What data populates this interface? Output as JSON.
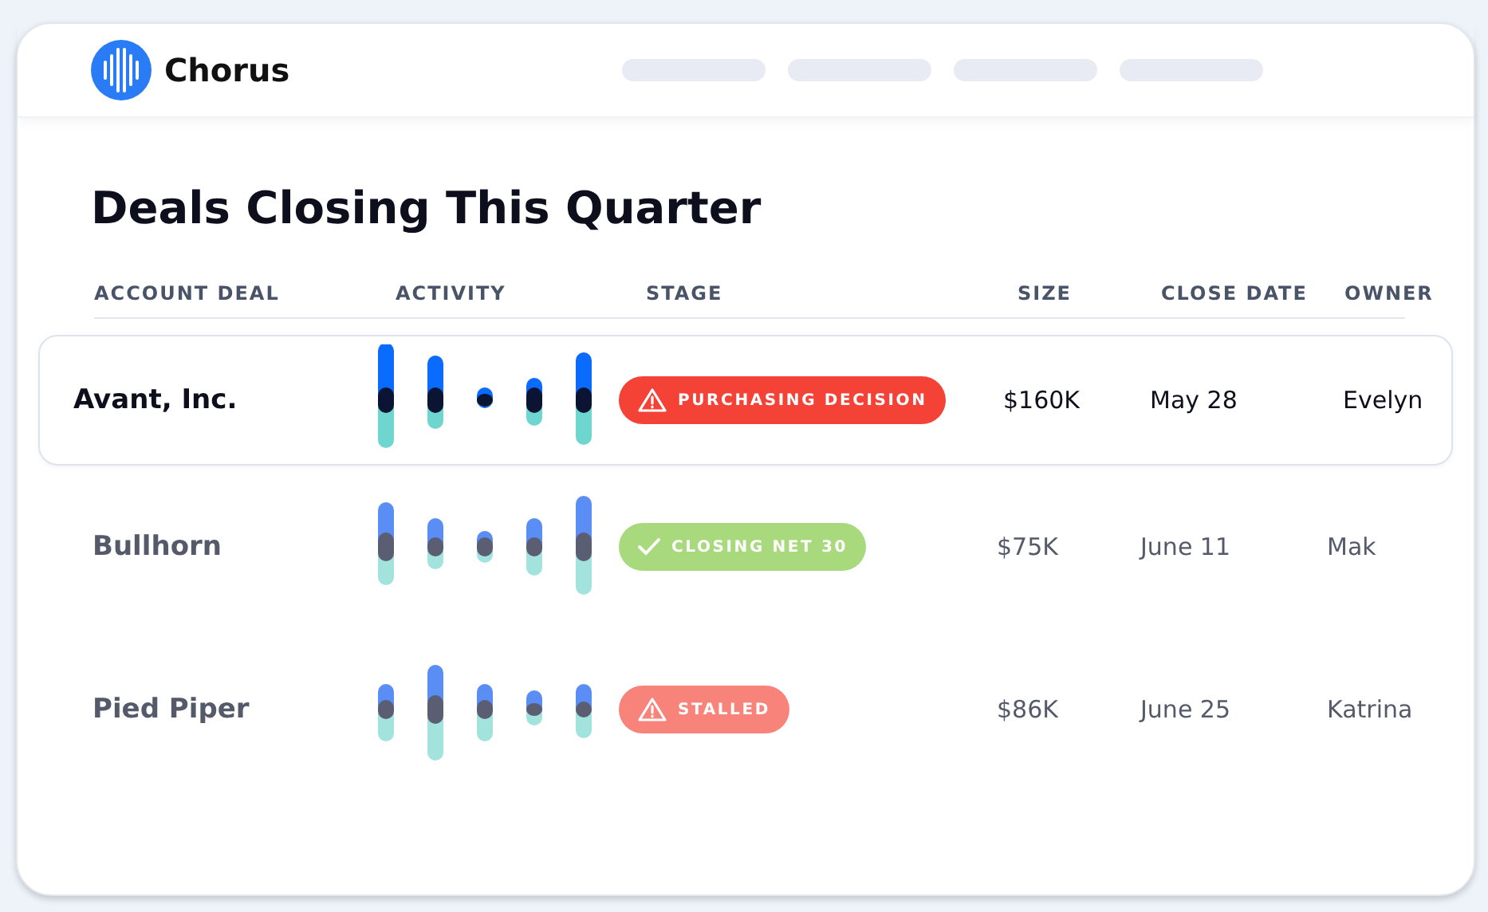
{
  "brand": {
    "name": "Chorus"
  },
  "title": "Deals Closing This Quarter",
  "table": {
    "columns": [
      "ACCOUNT DEAL",
      "ACTIVITY",
      "STAGE",
      "SIZE",
      "CLOSE DATE",
      "OWNER"
    ],
    "rows": [
      {
        "account": "Avant, Inc.",
        "selected": true,
        "stage": {
          "label": "PURCHASING DECISION",
          "kind": "warning",
          "color": "#f44336"
        },
        "size": "$160K",
        "close_date": "May 28",
        "owner": "Evelyn"
      },
      {
        "account": "Bullhorn",
        "selected": false,
        "stage": {
          "label": "CLOSING NET 30",
          "kind": "success",
          "color": "#a8d97c"
        },
        "size": "$75K",
        "close_date": "June 11",
        "owner": "Mak"
      },
      {
        "account": "Pied Piper",
        "selected": false,
        "stage": {
          "label": "STALLED",
          "kind": "warning",
          "color": "#f7837a"
        },
        "size": "$86K",
        "close_date": "June 25",
        "owner": "Katrina"
      }
    ]
  }
}
